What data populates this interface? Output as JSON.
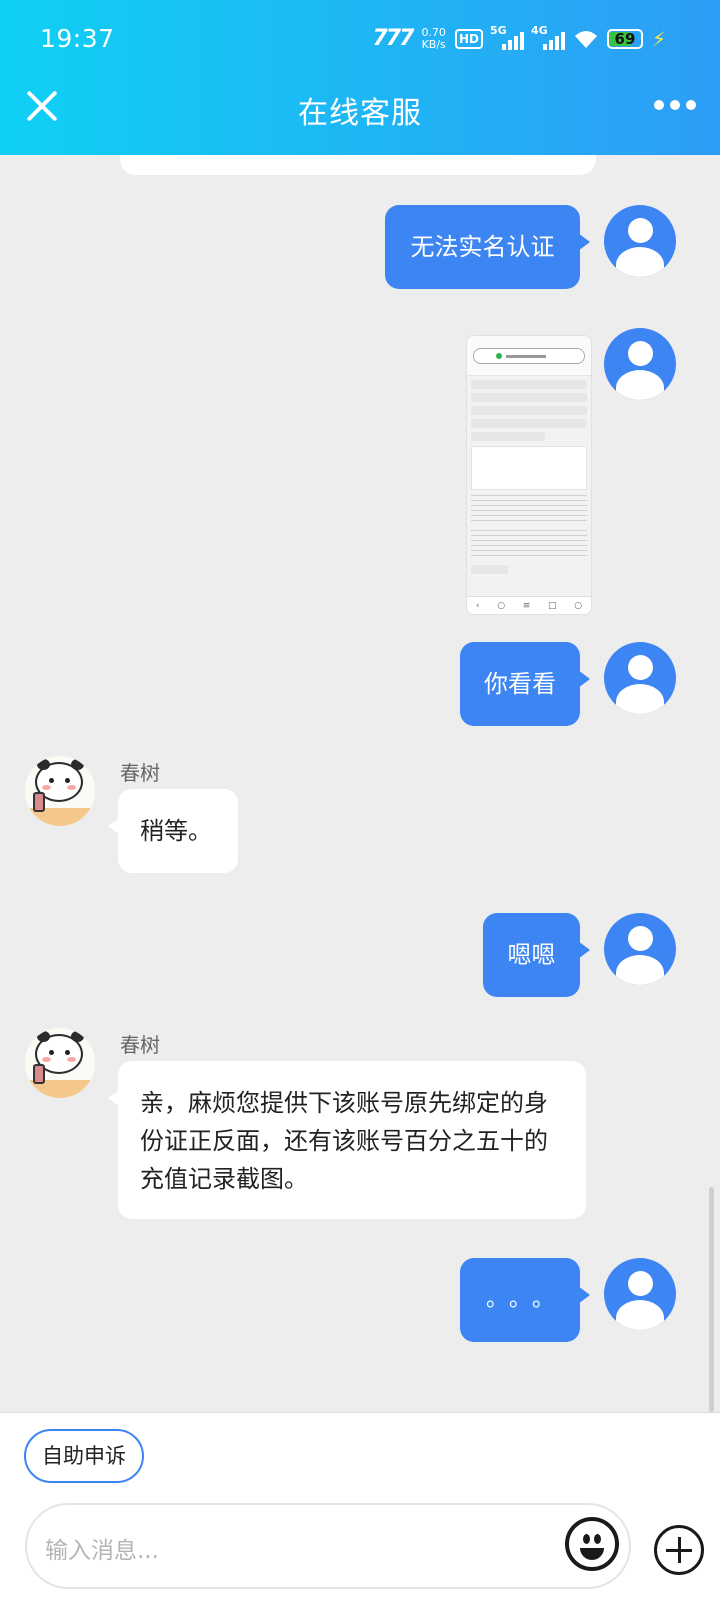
{
  "status_bar": {
    "time": "19:37",
    "net_speed_value": "0.70",
    "net_speed_unit": "KB/s",
    "hd_label": "HD",
    "signal_1": "5G",
    "signal_2": "4G",
    "battery": "69",
    "battery_level_percent": 69
  },
  "header": {
    "title": "在线客服",
    "close_icon": "close-icon",
    "more_icon": "more-dots-icon"
  },
  "messages": [
    {
      "from": "user",
      "type": "text",
      "text": "无法实名认证"
    },
    {
      "from": "user",
      "type": "image",
      "icon": "screenshot-thumbnail"
    },
    {
      "from": "user",
      "type": "text",
      "text": "你看看"
    },
    {
      "from": "agent",
      "sender": "春树",
      "type": "text",
      "text": "稍等。"
    },
    {
      "from": "user",
      "type": "text",
      "text": "嗯嗯"
    },
    {
      "from": "agent",
      "sender": "春树",
      "type": "text",
      "lines": [
        "亲，麻烦您提供下该账号原先绑定的身",
        "份证正反面，还有该账号百分之五十的",
        "充值记录截图。"
      ]
    },
    {
      "from": "user",
      "type": "text",
      "text": "。。。"
    }
  ],
  "bottom": {
    "quick_action": "自助申诉",
    "input_placeholder": "输入消息...",
    "emoji_icon": "emoji-icon",
    "plus_icon": "plus-icon"
  },
  "colors": {
    "accent": "#3d85f2",
    "header_gradient_start": "#0fd0f4",
    "header_gradient_end": "#2d9df5",
    "background": "#ededed"
  }
}
